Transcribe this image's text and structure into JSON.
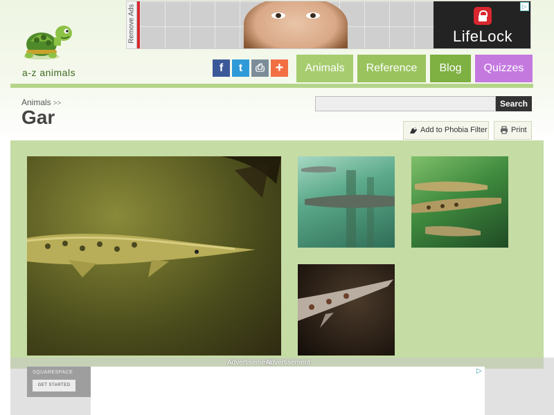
{
  "logo": {
    "text": "a-z animals"
  },
  "top_ad": {
    "remove_ads_label": "Remove Ads",
    "brand": "LifeLock"
  },
  "social": [
    {
      "name": "facebook",
      "glyph": "f",
      "color": "#3b5998"
    },
    {
      "name": "twitter",
      "glyph": "t",
      "color": "#2f9ad8"
    },
    {
      "name": "print",
      "glyph": "⎙",
      "color": "#7c8d99"
    },
    {
      "name": "share",
      "glyph": "+",
      "color": "#f26e43"
    }
  ],
  "nav": {
    "animals": "Animals",
    "reference": "Reference",
    "blog": "Blog",
    "quizzes": "Quizzes"
  },
  "breadcrumb": {
    "item": "Animals",
    "sep": ">>"
  },
  "page_title": "Gar",
  "search": {
    "value": "",
    "button_label": "Search"
  },
  "tools": {
    "phobia": "Add to Phobia Filter",
    "print": "Print"
  },
  "bottom_ad": {
    "label_a": "Advertisement",
    "label_b": "Advertisement",
    "brand": "SQUARESPACE",
    "cta": "GET STARTED"
  },
  "colors": {
    "nav_animals": "#a6cc6f",
    "nav_reference": "#9ac35e",
    "nav_blog": "#7eb042",
    "nav_quizzes": "#c479df",
    "gallery_bg": "#c5dca4"
  }
}
